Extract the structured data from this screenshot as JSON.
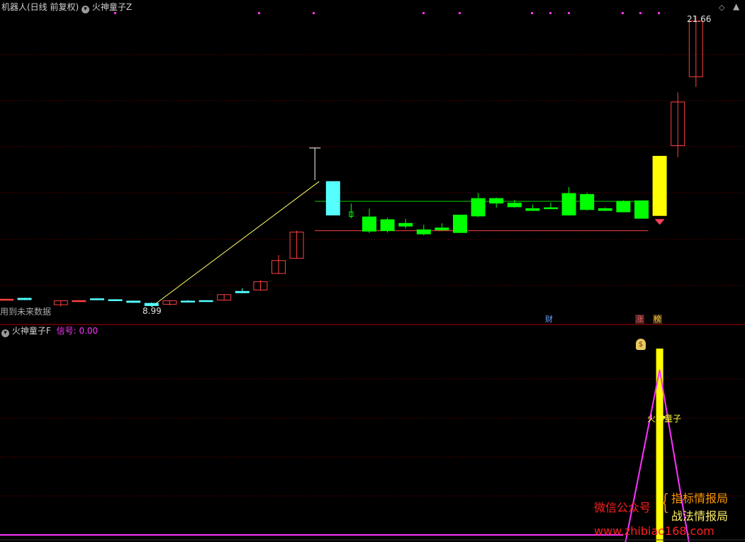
{
  "main_panel": {
    "title": "机器人(日线 前复权)",
    "indicator_name": "火神童子Z",
    "high_label": "21.66",
    "low_label": "8.99",
    "future_data_note": "用到未来数据",
    "markers": {
      "finance": "财",
      "rise": "涨",
      "rank": "榜"
    }
  },
  "sub_panel": {
    "indicator_name": "火神童子F",
    "signal_label": "信号:",
    "signal_value": "0.00",
    "annotation": "火神童子"
  },
  "watermark": {
    "wechat_label": "微信公众号",
    "brace": "{",
    "name_1": "指标情报局",
    "name_2": "战法情报局",
    "url": "www.zhibiao168.com"
  },
  "colors": {
    "up": "#ff4040",
    "down": "#00ff00",
    "doji": "#55ffff",
    "highlight": "#ffff00",
    "signal_line": "#ff33ff",
    "grid": "#8b0000"
  },
  "icons": {
    "collapse": "chevron-down-icon",
    "settings": "diamond-icon"
  },
  "chart_data": {
    "type": "candlestick",
    "price_range": [
      8.99,
      21.66
    ],
    "signal_range": [
      0,
      1
    ],
    "candles": [
      {
        "o": 9.32,
        "c": 9.32,
        "h": 9.34,
        "l": 9.3,
        "kind": "doji"
      },
      {
        "o": 9.3,
        "c": 9.36,
        "h": 9.38,
        "l": 9.28,
        "kind": "cyan"
      },
      {
        "o": null,
        "c": null,
        "h": null,
        "l": null,
        "kind": "gap"
      },
      {
        "o": 9.08,
        "c": 9.25,
        "h": 9.27,
        "l": 9.0,
        "kind": "up"
      },
      {
        "o": 9.26,
        "c": 9.26,
        "h": 9.28,
        "l": 9.24,
        "kind": "doji"
      },
      {
        "o": 9.3,
        "c": 9.34,
        "h": 9.36,
        "l": 9.28,
        "kind": "cyan"
      },
      {
        "o": 9.26,
        "c": 9.3,
        "h": 9.32,
        "l": 9.24,
        "kind": "cyan"
      },
      {
        "o": 9.18,
        "c": 9.24,
        "h": 9.26,
        "l": 9.16,
        "kind": "cyan"
      },
      {
        "o": 9.04,
        "c": 9.14,
        "h": 9.18,
        "l": 8.99,
        "kind": "cyan"
      },
      {
        "o": 9.1,
        "c": 9.25,
        "h": 9.27,
        "l": 9.05,
        "kind": "up"
      },
      {
        "o": 9.22,
        "c": 9.24,
        "h": 9.28,
        "l": 9.2,
        "kind": "cyan"
      },
      {
        "o": 9.24,
        "c": 9.26,
        "h": 9.28,
        "l": 9.22,
        "kind": "cyan"
      },
      {
        "o": 9.28,
        "c": 9.52,
        "h": 9.54,
        "l": 9.26,
        "kind": "up"
      },
      {
        "o": 9.6,
        "c": 9.66,
        "h": 9.8,
        "l": 9.58,
        "kind": "cyan"
      },
      {
        "o": 9.72,
        "c": 10.08,
        "h": 10.14,
        "l": 9.7,
        "kind": "up"
      },
      {
        "o": 10.44,
        "c": 11.0,
        "h": 11.24,
        "l": 10.42,
        "kind": "up"
      },
      {
        "o": 11.1,
        "c": 12.24,
        "h": 12.3,
        "l": 11.08,
        "kind": "up"
      },
      {
        "o": null,
        "c": null,
        "h": null,
        "l": null,
        "kind": "gap"
      },
      {
        "o": 14.44,
        "c": 12.98,
        "h": 14.44,
        "l": 12.98,
        "kind": "cyan"
      },
      {
        "o": 13.12,
        "c": 12.92,
        "h": 13.48,
        "l": 12.84,
        "kind": "hollowgreen"
      },
      {
        "o": 12.9,
        "c": 12.28,
        "h": 13.26,
        "l": 12.2,
        "kind": "down"
      },
      {
        "o": 12.78,
        "c": 12.3,
        "h": 12.86,
        "l": 12.22,
        "kind": "down"
      },
      {
        "o": 12.62,
        "c": 12.5,
        "h": 12.82,
        "l": 12.4,
        "kind": "down"
      },
      {
        "o": 12.34,
        "c": 12.16,
        "h": 12.56,
        "l": 12.1,
        "kind": "down"
      },
      {
        "o": 12.42,
        "c": 12.34,
        "h": 12.62,
        "l": 12.3,
        "kind": "down"
      },
      {
        "o": 12.98,
        "c": 12.22,
        "h": 13.0,
        "l": 12.2,
        "kind": "down"
      },
      {
        "o": 13.7,
        "c": 12.94,
        "h": 13.94,
        "l": 12.9,
        "kind": "down"
      },
      {
        "o": 13.7,
        "c": 13.5,
        "h": 13.74,
        "l": 13.3,
        "kind": "down"
      },
      {
        "o": 13.5,
        "c": 13.34,
        "h": 13.64,
        "l": 13.3,
        "kind": "down"
      },
      {
        "o": 13.26,
        "c": 13.18,
        "h": 13.44,
        "l": 13.16,
        "kind": "down"
      },
      {
        "o": 13.3,
        "c": 13.26,
        "h": 13.52,
        "l": 13.24,
        "kind": "down"
      },
      {
        "o": 13.92,
        "c": 12.98,
        "h": 14.2,
        "l": 12.96,
        "kind": "down"
      },
      {
        "o": 13.88,
        "c": 13.22,
        "h": 13.96,
        "l": 13.18,
        "kind": "down"
      },
      {
        "o": 13.26,
        "c": 13.18,
        "h": 13.32,
        "l": 13.16,
        "kind": "down"
      },
      {
        "o": 13.58,
        "c": 13.12,
        "h": 13.62,
        "l": 13.1,
        "kind": "down"
      },
      {
        "o": 13.6,
        "c": 12.84,
        "h": 13.62,
        "l": 12.82,
        "kind": "down"
      },
      {
        "o": 12.96,
        "c": 15.54,
        "h": 15.54,
        "l": 12.96,
        "kind": "yellow"
      },
      {
        "o": 16.0,
        "c": 17.9,
        "h": 18.32,
        "l": 15.5,
        "kind": "up"
      },
      {
        "o": 19.0,
        "c": 21.42,
        "h": 21.66,
        "l": 18.56,
        "kind": "up"
      }
    ],
    "signal": [
      0,
      0,
      0,
      0,
      0,
      0,
      0,
      0,
      0,
      0,
      0,
      0,
      0,
      0,
      0,
      0,
      0,
      0,
      0,
      0,
      0,
      0,
      0,
      0,
      0,
      0,
      0,
      0,
      0,
      0,
      0,
      0,
      0,
      0,
      0,
      0,
      1,
      0,
      0
    ]
  }
}
